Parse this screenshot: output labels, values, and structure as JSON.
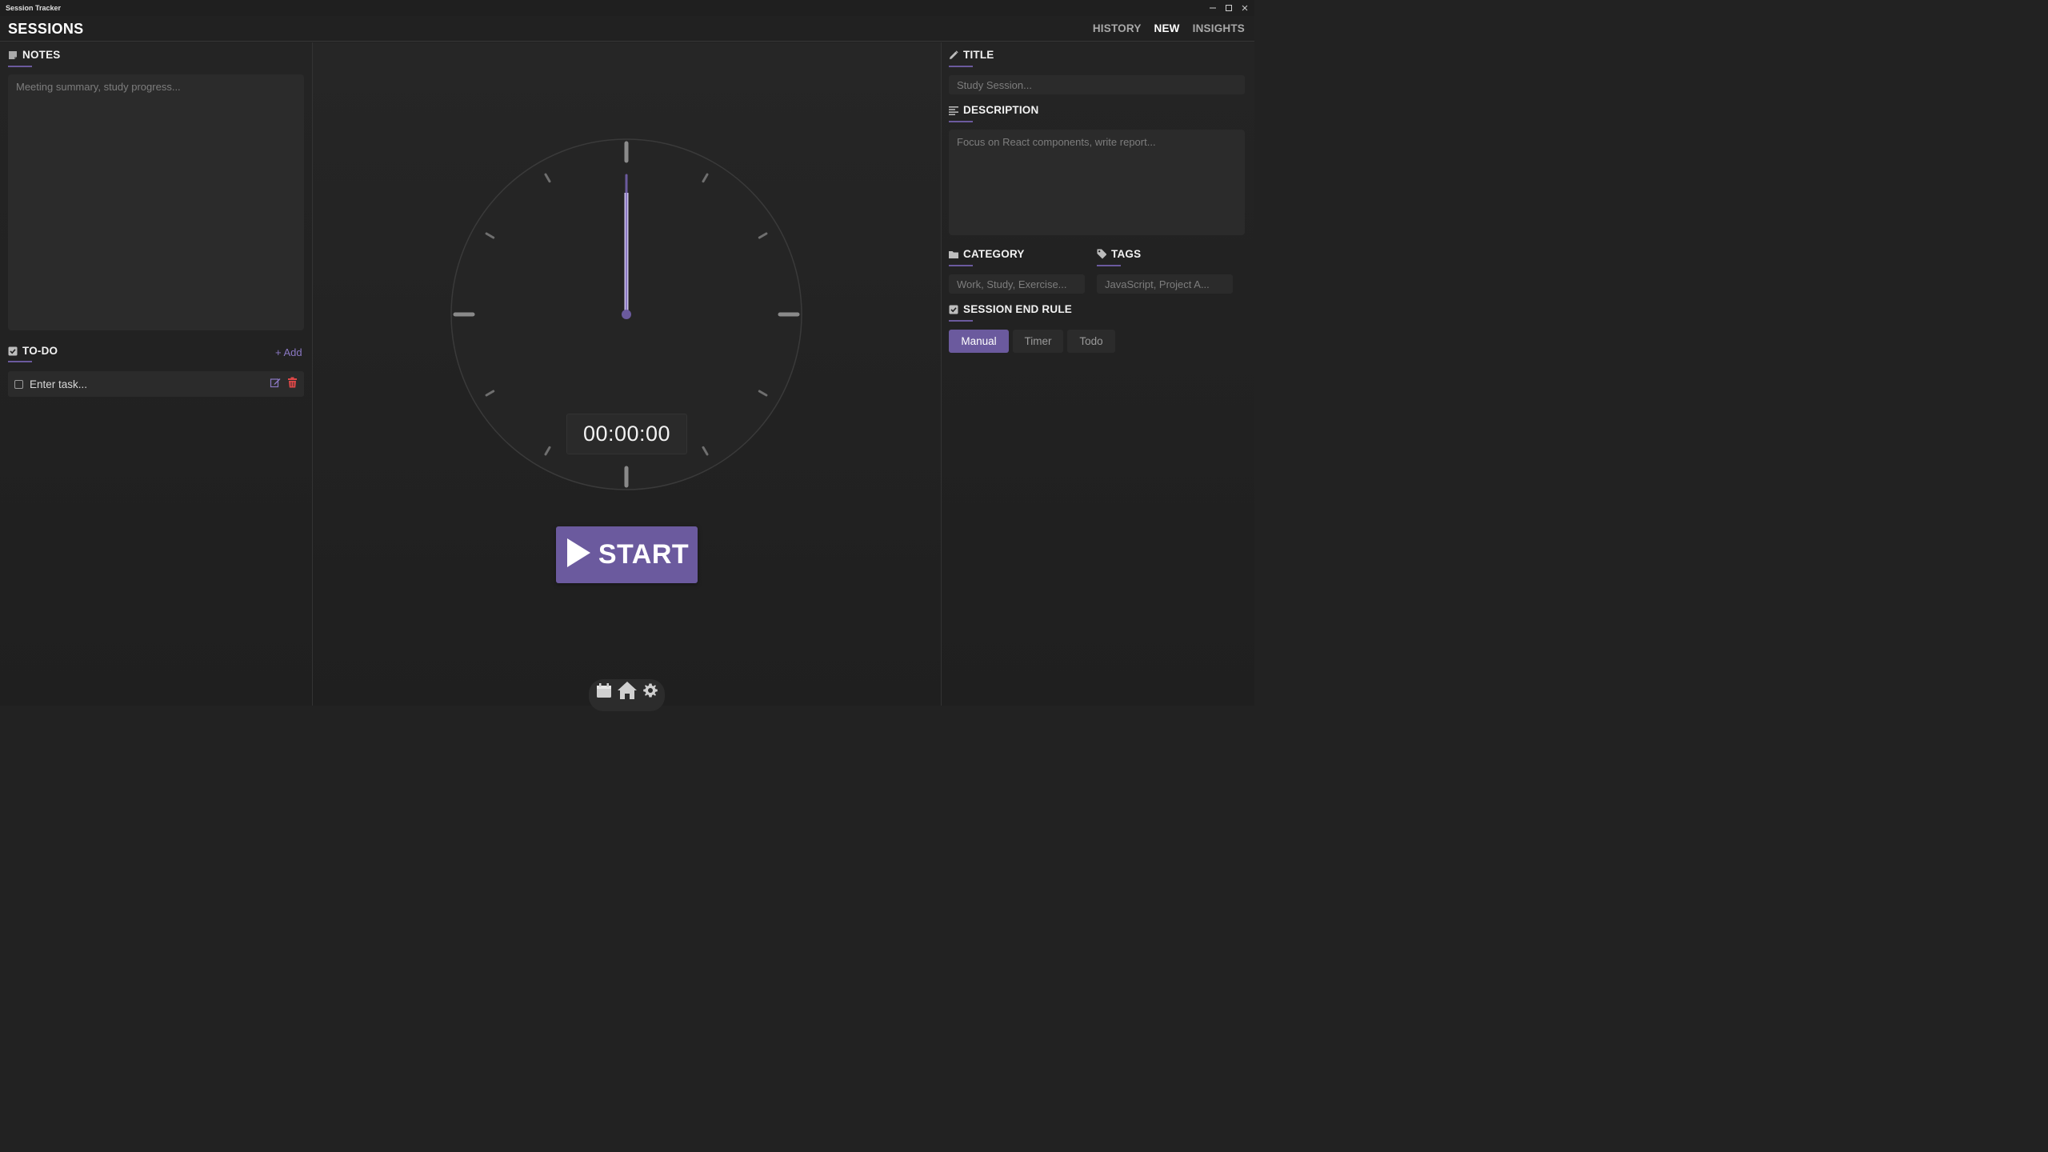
{
  "window": {
    "title": "Session Tracker"
  },
  "header": {
    "brand": "SESSIONS",
    "nav": [
      {
        "label": "HISTORY",
        "active": false
      },
      {
        "label": "NEW",
        "active": true
      },
      {
        "label": "INSIGHTS",
        "active": false
      }
    ]
  },
  "left": {
    "notes": {
      "heading": "NOTES",
      "placeholder": "Meeting summary, study progress..."
    },
    "todo": {
      "heading": "TO-DO",
      "add_label": "+ Add",
      "items": [
        {
          "text": "Enter task...",
          "checked": false
        }
      ]
    }
  },
  "center": {
    "timer": "00:00:00",
    "start_label": "START"
  },
  "right": {
    "title": {
      "heading": "TITLE",
      "placeholder": "Study Session..."
    },
    "description": {
      "heading": "DESCRIPTION",
      "placeholder": "Focus on React components, write report..."
    },
    "category": {
      "heading": "CATEGORY",
      "placeholder": "Work, Study, Exercise..."
    },
    "tags": {
      "heading": "TAGS",
      "placeholder": "JavaScript, Project A..."
    },
    "end_rule": {
      "heading": "SESSION END RULE",
      "options": [
        {
          "label": "Manual",
          "active": true
        },
        {
          "label": "Timer",
          "active": false
        },
        {
          "label": "Todo",
          "active": false
        }
      ]
    }
  },
  "dock": {
    "icons": [
      "calendar-icon",
      "home-icon",
      "gear-icon"
    ]
  },
  "colors": {
    "accent": "#6b5a9e",
    "background": "#222222",
    "danger": "#e04848"
  }
}
